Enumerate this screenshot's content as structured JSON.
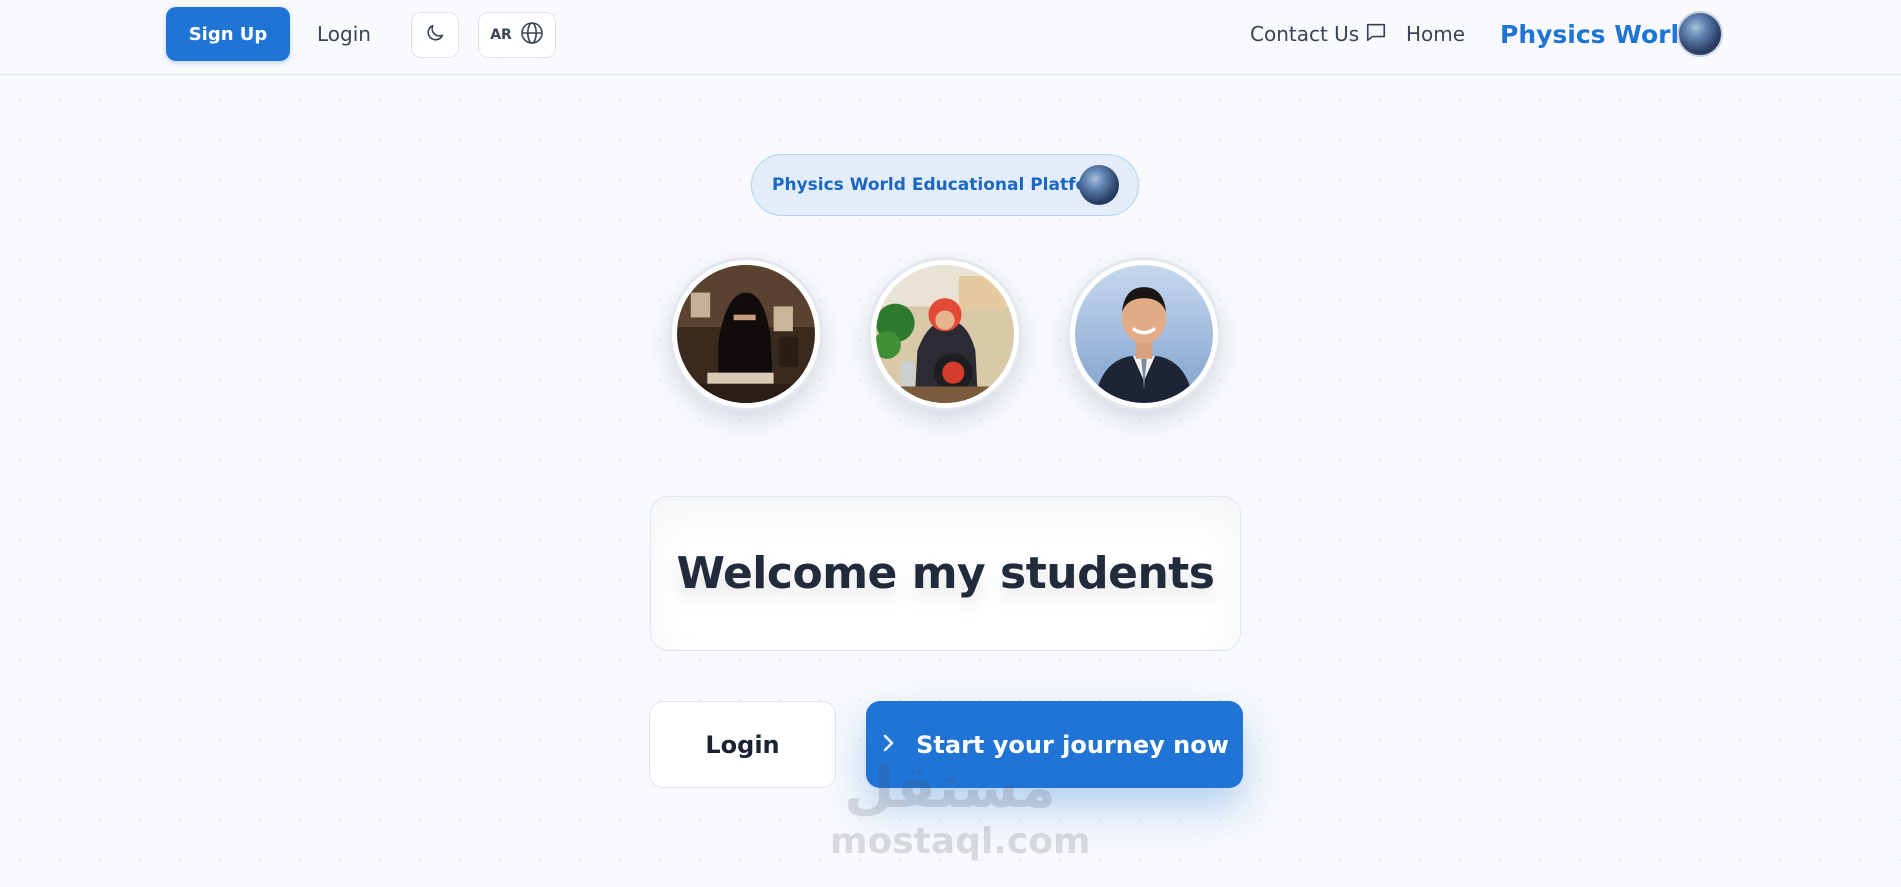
{
  "header": {
    "signup_label": "Sign Up",
    "login_label": "Login",
    "language_code": "AR",
    "contact_label": "Contact Us",
    "home_label": "Home",
    "brand_name": "Physics World"
  },
  "badge": {
    "text": "Physics World Educational Platform"
  },
  "teachers": [
    "teacher-photo",
    "teacher-photo",
    "teacher-photo"
  ],
  "welcome": {
    "title": "Welcome my students"
  },
  "actions": {
    "login_label": "Login",
    "start_label": "Start your journey now"
  },
  "watermark": {
    "arabic": "مستقل",
    "latin": "mostaql.com"
  },
  "colors": {
    "accent": "#1f74d6",
    "background": "#f7f9fc",
    "text": "#1e2738"
  },
  "icons": {
    "theme": "moon-icon",
    "language": "globe-icon",
    "contact": "chat-icon",
    "cta": "chevron-right-icon"
  }
}
